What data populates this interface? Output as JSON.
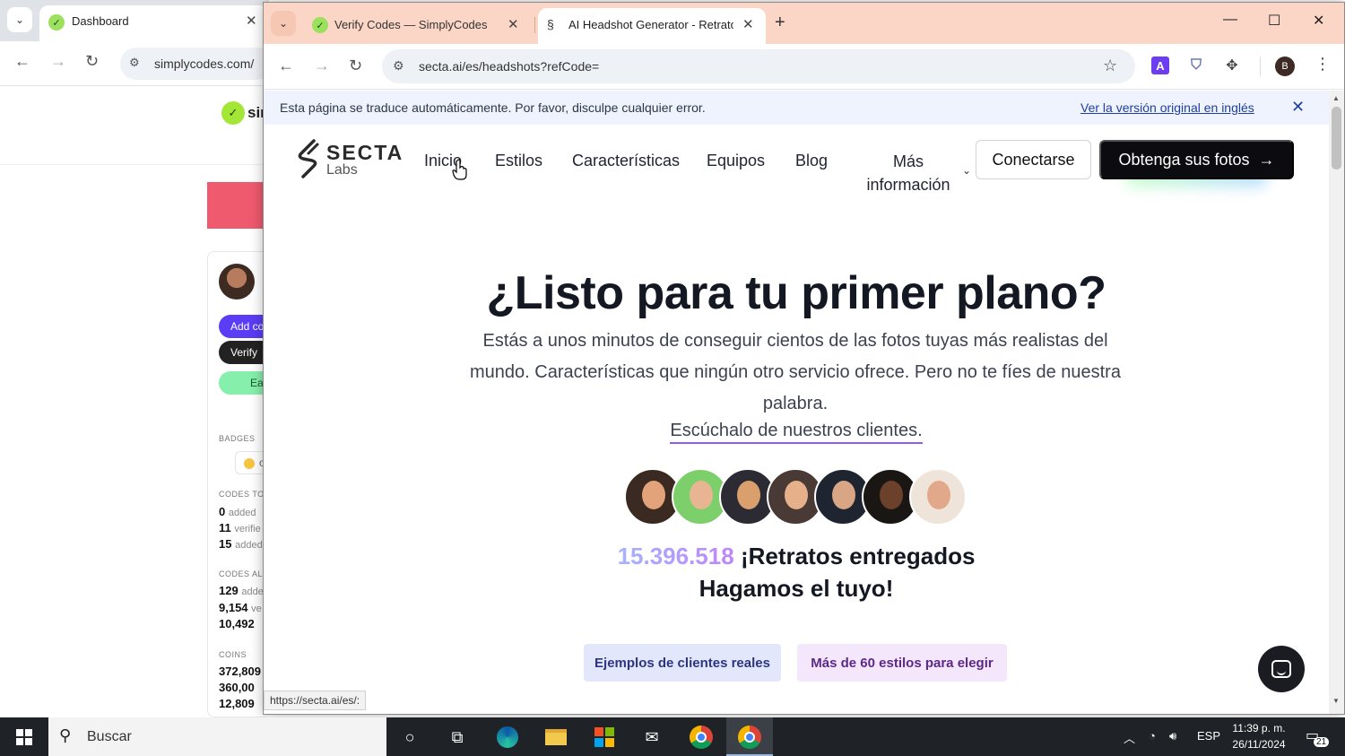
{
  "back_window": {
    "tab_title": "Dashboard",
    "url": "simplycodes.com/",
    "logo_text": "sir",
    "buttons": {
      "add": "Add co",
      "verify": "Verify",
      "earn": "Ear"
    },
    "badges_label": "BADGES",
    "badge_text": "o",
    "codes_today_label": "CODES TO",
    "codes_today": [
      {
        "value": "0",
        "unit": "added"
      },
      {
        "value": "11",
        "unit": "verifie"
      },
      {
        "value": "15",
        "unit": "added"
      }
    ],
    "codes_all_label": "CODES AL",
    "codes_all": [
      {
        "value": "129",
        "unit": "adde"
      },
      {
        "value": "9,154",
        "unit": "ve"
      },
      {
        "value": "10,492",
        "unit": ""
      }
    ],
    "coins_label": "COINS",
    "coins": [
      "372,809",
      "360,00",
      "12,809"
    ]
  },
  "front_window": {
    "tabs": [
      {
        "title": "Verify Codes — SimplyCodes",
        "active": false
      },
      {
        "title": "AI Headshot Generator - Retratos",
        "active": true
      }
    ],
    "url": "secta.ai/es/headshots?refCode=",
    "profile_initial": "B",
    "extension_letter": "A",
    "translate_bar": {
      "message": "Esta página se traduce automáticamente. Por favor, disculpe cualquier error.",
      "link": "Ver la versión original en inglés"
    },
    "status_url": "https://secta.ai/es/:"
  },
  "site": {
    "logo_main": "SECTA",
    "logo_sub": "Labs",
    "nav": [
      "Inicio",
      "Estilos",
      "Características",
      "Equipos",
      "Blog"
    ],
    "nav_more": "Más información",
    "login_label": "Conectarse",
    "cta_label": "Obtenga sus fotos",
    "hero_title": "¿Listo para tu primer plano?",
    "hero_subtitle": "Estás a unos minutos de conseguir cientos de las fotos tuyas más realistas del mundo. Características que ningún otro servicio ofrece. Pero no te fíes de nuestra palabra.",
    "hero_link": "Escúchalo de nuestros clientes.",
    "portraits_count": "15.396.518",
    "portraits_text": "¡Retratos entregados",
    "portraits_cta": "Hagamos el tuyo!",
    "button_examples": "Ejemplos de clientes reales",
    "button_styles": "Más de 60 estilos para elegir"
  },
  "taskbar": {
    "search_placeholder": "Buscar",
    "language": "ESP",
    "time": "11:39 p. m.",
    "date": "26/11/2024",
    "notifications": "21"
  },
  "colors": {
    "tabstrip_front": "#fbd6c6",
    "cta_bg": "#0b0b10",
    "accent_purple": "#8b5cf6",
    "taskbar_bg": "#1f2327"
  }
}
